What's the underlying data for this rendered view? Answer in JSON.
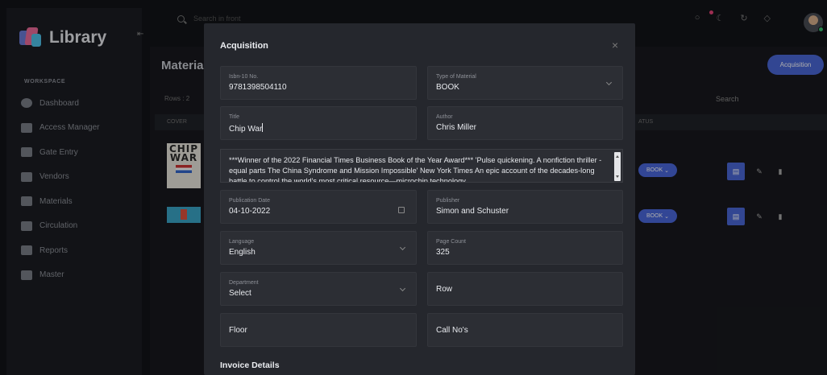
{
  "app": {
    "name": "Library"
  },
  "sidebar": {
    "workspace_label": "WORKSPACE",
    "items": [
      {
        "label": "Dashboard",
        "icon": "dashboard-icon"
      },
      {
        "label": "Access Manager",
        "icon": "users-icon"
      },
      {
        "label": "Gate Entry",
        "icon": "gate-icon"
      },
      {
        "label": "Vendors",
        "icon": "store-icon"
      },
      {
        "label": "Materials",
        "icon": "books-icon"
      },
      {
        "label": "Circulation",
        "icon": "circulation-icon"
      },
      {
        "label": "Reports",
        "icon": "reports-icon"
      },
      {
        "label": "Master",
        "icon": "master-icon"
      }
    ]
  },
  "topbar": {
    "search_placeholder": "Search in front"
  },
  "page": {
    "title": "Materia",
    "acquisition_button": "Acquisition",
    "rows_label": "Rows :",
    "rows_value": "2",
    "search_label": "Search",
    "columns": {
      "cover": "COVER",
      "status": "ATUS"
    },
    "books": [
      {
        "cover_text": "CHIP WAR",
        "status": "BOOK"
      },
      {
        "status": "BOOK"
      }
    ]
  },
  "modal": {
    "title": "Acquisition",
    "close": "×",
    "fields": {
      "isbn": {
        "label": "Isbn-10 No.",
        "value": "9781398504110"
      },
      "type": {
        "label": "Type of Material",
        "value": "BOOK"
      },
      "title": {
        "label": "Title",
        "value": "Chip War"
      },
      "author": {
        "label": "Author",
        "value": "Chris Miller"
      },
      "description": "***Winner of the 2022 Financial Times Business Book of the Year Award*** 'Pulse quickening. A nonfiction thriller - equal parts The China Syndrome and Mission Impossible' New York Times An epic account of the decades-long battle to control the world's most critical resource—microchip technology",
      "publication_date": {
        "label": "Publication Date",
        "value": "04-10-2022"
      },
      "publisher": {
        "label": "Publisher",
        "value": "Simon and Schuster"
      },
      "language": {
        "label": "Language",
        "value": "English"
      },
      "page_count": {
        "label": "Page Count",
        "value": "325"
      },
      "department": {
        "label": "Department",
        "value": "Select"
      },
      "row": {
        "placeholder": "Row"
      },
      "floor": {
        "placeholder": "Floor"
      },
      "call_no": {
        "placeholder": "Call No's"
      }
    },
    "invoice_title": "Invoice Details"
  }
}
